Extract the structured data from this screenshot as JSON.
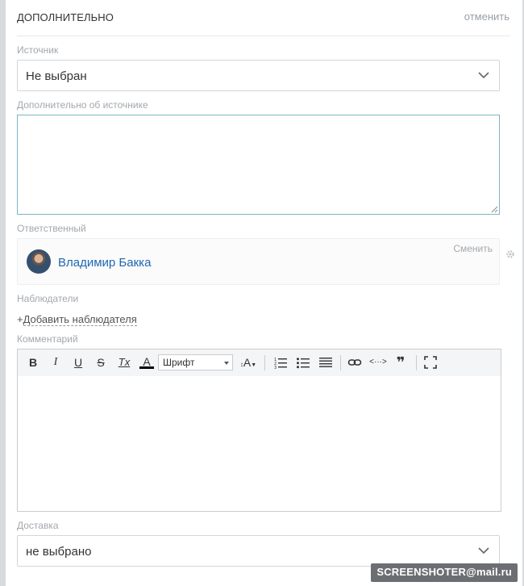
{
  "section": {
    "title": "ДОПОЛНИТЕЛЬНО",
    "cancel_label": "отменить"
  },
  "source": {
    "label": "Источник",
    "value": "Не выбран"
  },
  "source_details": {
    "label": "Дополнительно об источнике",
    "value": ""
  },
  "responsible": {
    "label": "Ответственный",
    "name": "Владимир Бакка",
    "change_label": "Сменить"
  },
  "observers": {
    "label": "Наблюдатели",
    "add_prefix": "+",
    "add_label": "Добавить наблюдателя"
  },
  "comment": {
    "label": "Комментарий",
    "toolbar": {
      "bold": "B",
      "italic": "I",
      "underline": "U",
      "strike": "S",
      "clear_format": "Tx",
      "font_color": "A",
      "font_select": "Шрифт",
      "font_size": "A",
      "numbered_list": "ordered-list-icon",
      "bulleted_list": "unordered-list-icon",
      "align": "align-icon",
      "link": "link-icon",
      "code": "<···>",
      "quote": "❞",
      "fullscreen": "fullscreen-icon"
    },
    "value": ""
  },
  "delivery": {
    "label": "Доставка",
    "value": "не выбрано"
  },
  "watermark": {
    "text": "SCREENSHOTER@mail.ru"
  },
  "colors": {
    "accent": "#2067b0",
    "focus_border": "#7ab6c6",
    "muted": "#a3a8ad"
  }
}
